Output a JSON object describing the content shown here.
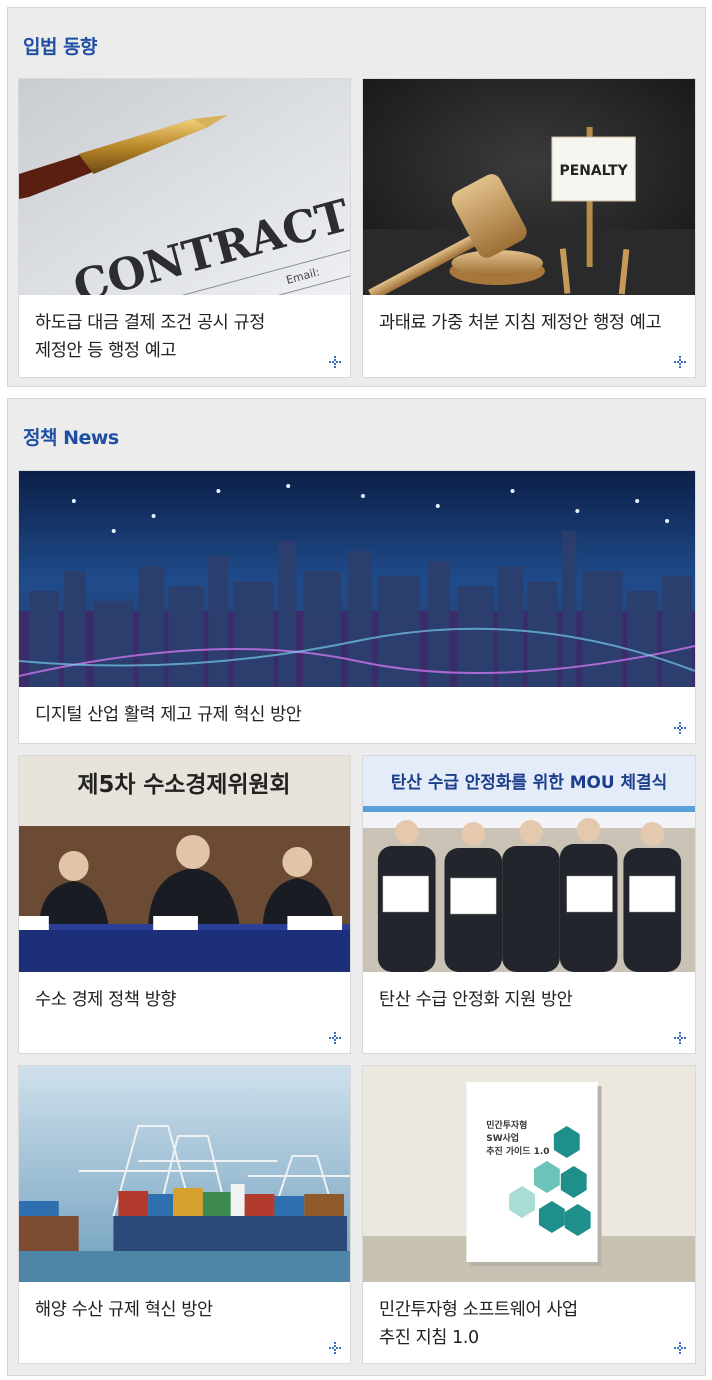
{
  "sections": {
    "legislation": {
      "title": "입법 동향",
      "cards": [
        {
          "caption": "하도급 대금 결제 조건 공시 규정\n제정안 등 행정 예고",
          "image_text": "CONTRACT",
          "image_text2": "Email:"
        },
        {
          "caption": "과태료 가중 처분 지침 제정안 행정 예고",
          "image_text": "PENALTY"
        }
      ]
    },
    "policy": {
      "title": "정책 News",
      "featured": {
        "caption": "디지털 산업 활력 제고 규제 혁신 방안"
      },
      "cards": [
        {
          "caption": "수소 경제 정책 방향",
          "banner": "제5차 수소경제위원회"
        },
        {
          "caption": "탄산 수급 안정화 지원 방안",
          "banner": "탄산 수급 안정화를 위한 MOU 체결식"
        },
        {
          "caption": "해양 수산 규제 혁신 방안"
        },
        {
          "caption": "민간투자형 소프트웨어 사업\n추진 지침 1.0",
          "book_title": "민간투자형\nSW사업\n추진 가이드 1.0"
        }
      ]
    }
  },
  "icons": {
    "more": "plus-dots-icon"
  },
  "colors": {
    "title": "#1f4fa3",
    "section_bg": "#ececec",
    "more_icon": "#3a6cc8"
  }
}
